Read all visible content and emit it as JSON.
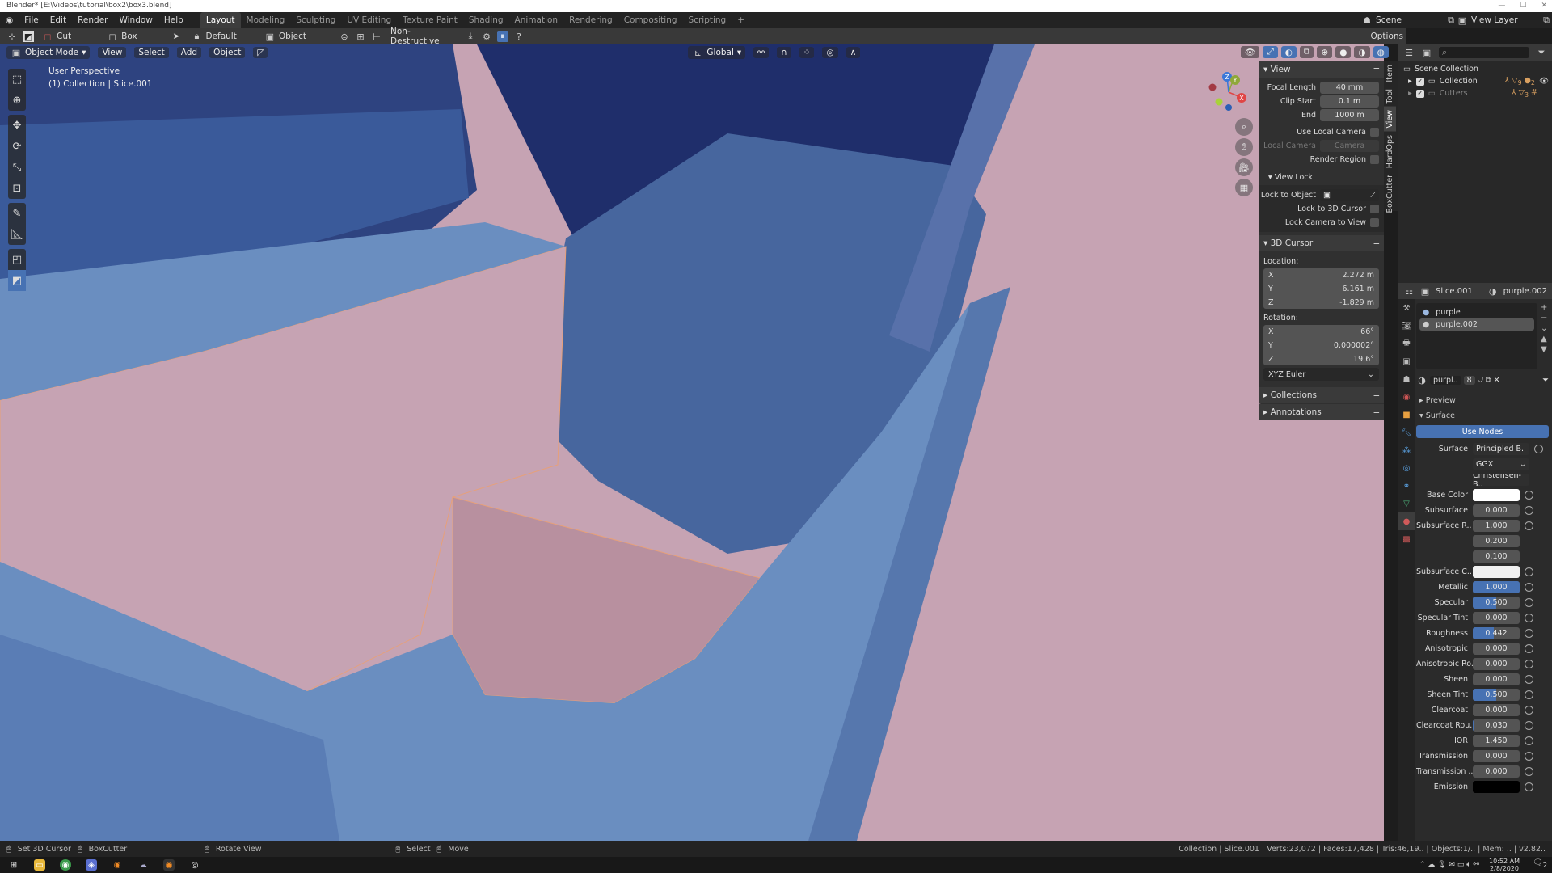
{
  "window": {
    "title": "Blender* [E:\\Videos\\tutorial\\box2\\box3.blend]"
  },
  "menu": {
    "items": [
      "File",
      "Edit",
      "Render",
      "Window",
      "Help"
    ]
  },
  "workspaces": {
    "tabs": [
      "Layout",
      "Modeling",
      "Sculpting",
      "UV Editing",
      "Texture Paint",
      "Shading",
      "Animation",
      "Rendering",
      "Compositing",
      "Scripting",
      "+"
    ],
    "active": "Layout"
  },
  "scene": {
    "label": "Scene",
    "view_layer": "View Layer"
  },
  "tool_header": {
    "mode": "Cut",
    "shape": "Box",
    "pivot": "Default",
    "target": "Object",
    "boolean_mode": "Non-Destructive",
    "options": "Options"
  },
  "viewport_header": {
    "mode": "Object Mode",
    "menus": [
      "View",
      "Select",
      "Add",
      "Object"
    ],
    "orientation": "Global"
  },
  "viewport_info": {
    "line1": "User Perspective",
    "line2": "(1) Collection | Slice.001"
  },
  "gizmo": {
    "x": "X",
    "y": "Y",
    "z": "Z"
  },
  "npanel": {
    "tabs": [
      "Item",
      "Tool",
      "View",
      "HardOps",
      "BoxCutter"
    ],
    "active_tab": "View",
    "view": {
      "title": "View",
      "focal_length_label": "Focal Length",
      "focal_length": "40 mm",
      "clip_start_label": "Clip Start",
      "clip_start": "0.1 m",
      "end_label": "End",
      "end": "1000 m",
      "use_local_camera": "Use Local Camera",
      "local_camera_label": "Local Camera",
      "local_camera": "Camera",
      "render_region": "Render Region"
    },
    "view_lock": {
      "title": "View Lock",
      "lock_to_object": "Lock to Object",
      "lock_3d_cursor": "Lock to 3D Cursor",
      "lock_camera": "Lock Camera to View"
    },
    "cursor": {
      "title": "3D Cursor",
      "location_label": "Location:",
      "loc": [
        {
          "axis": "X",
          "value": "2.272 m"
        },
        {
          "axis": "Y",
          "value": "6.161 m"
        },
        {
          "axis": "Z",
          "value": "-1.829 m"
        }
      ],
      "rotation_label": "Rotation:",
      "rot": [
        {
          "axis": "X",
          "value": "66°"
        },
        {
          "axis": "Y",
          "value": "0.000002°"
        },
        {
          "axis": "Z",
          "value": "19.6°"
        }
      ],
      "rotation_mode": "XYZ Euler"
    },
    "collections": "Collections",
    "annotations": "Annotations"
  },
  "outliner": {
    "root": "Scene Collection",
    "items": [
      {
        "name": "Collection",
        "badge1": "9",
        "badge2": "2"
      },
      {
        "name": "Cutters",
        "badge1": "3"
      }
    ]
  },
  "properties": {
    "object": "Slice.001",
    "material": "purple.002",
    "slots": [
      "purple",
      "purple.002"
    ],
    "active_slot": "purple.002",
    "mat_name": "purpl..",
    "users": "8",
    "preview": "Preview",
    "surface_panel": "Surface",
    "use_nodes": "Use Nodes",
    "surface_label": "Surface",
    "surface_shader": "Principled B..",
    "distribution": "GGX",
    "subsurface_method": "Christensen-B..",
    "fields": [
      {
        "label": "Base Color",
        "type": "color",
        "color": "#ffffff"
      },
      {
        "label": "Subsurface",
        "value": "0.000",
        "fill": 0
      },
      {
        "label": "Subsurface R..",
        "value": "1.000",
        "fill": 0
      },
      {
        "label": "",
        "value": "0.200",
        "fill": 0
      },
      {
        "label": "",
        "value": "0.100",
        "fill": 0
      },
      {
        "label": "Subsurface C..",
        "type": "color",
        "color": "#f0f0f0"
      },
      {
        "label": "Metallic",
        "value": "1.000",
        "fill": 1.0
      },
      {
        "label": "Specular",
        "value": "0.500",
        "fill": 0.5
      },
      {
        "label": "Specular Tint",
        "value": "0.000",
        "fill": 0
      },
      {
        "label": "Roughness",
        "value": "0.442",
        "fill": 0.442
      },
      {
        "label": "Anisotropic",
        "value": "0.000",
        "fill": 0
      },
      {
        "label": "Anisotropic Ro..",
        "value": "0.000",
        "fill": 0
      },
      {
        "label": "Sheen",
        "value": "0.000",
        "fill": 0
      },
      {
        "label": "Sheen Tint",
        "value": "0.500",
        "fill": 0.5
      },
      {
        "label": "Clearcoat",
        "value": "0.000",
        "fill": 0
      },
      {
        "label": "Clearcoat Rou..",
        "value": "0.030",
        "fill": 0.03
      },
      {
        "label": "IOR",
        "value": "1.450",
        "fill": 0
      },
      {
        "label": "Transmission",
        "value": "0.000",
        "fill": 0
      },
      {
        "label": "Transmission ..",
        "value": "0.000",
        "fill": 0
      },
      {
        "label": "Emission",
        "type": "color",
        "color": "#000000"
      }
    ]
  },
  "statusbar": {
    "left": [
      "Set 3D Cursor",
      "BoxCutter",
      "Rotate View",
      "Select",
      "Move"
    ],
    "stats": "Collection | Slice.001 | Verts:23,072 | Faces:17,428 | Tris:46,19.. | Objects:1/.. | Mem: .. | v2.82.."
  },
  "taskbar": {
    "time": "10:52 AM",
    "date": "2/8/2020",
    "notifications": "2"
  },
  "colors": {
    "accent": "#4772b3",
    "pink": "#c6a3b3",
    "blue_obj": "#6a8ec0",
    "dark_blue": "#22316d"
  }
}
